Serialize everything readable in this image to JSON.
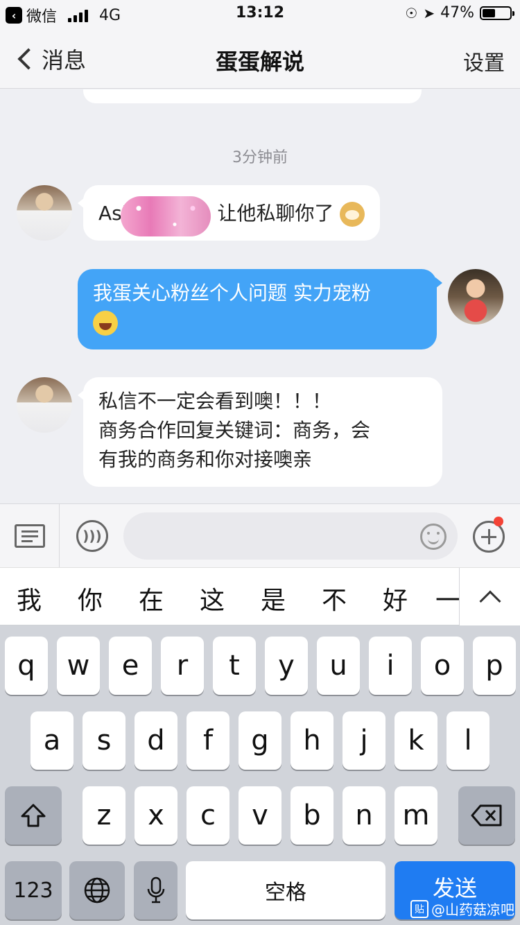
{
  "status_bar": {
    "carrier": "微信",
    "network": "4G",
    "time": "13:12",
    "battery": "47%",
    "battery_level": 0.47
  },
  "nav": {
    "back_label": "消息",
    "title": "蛋蛋解说",
    "right_label": "设置"
  },
  "chat": {
    "timestamp": "3分钟前",
    "messages": [
      {
        "direction": "in",
        "text_before": "Asl",
        "text_after": "让他私聊你了",
        "emoji": "doge"
      },
      {
        "direction": "out",
        "text": "我蛋关心粉丝个人问题 实力宠粉",
        "emoji": "laugh"
      },
      {
        "direction": "in",
        "lines": [
          "私信不一定会看到噢！！！",
          "商务合作回复关键词：商务，会",
          "有我的商务和你对接噢亲"
        ]
      }
    ]
  },
  "input": {
    "value": "",
    "placeholder": ""
  },
  "candidates": [
    "我",
    "你",
    "在",
    "这",
    "是",
    "不",
    "好",
    "一"
  ],
  "keyboard": {
    "row1": [
      "q",
      "w",
      "e",
      "r",
      "t",
      "y",
      "u",
      "i",
      "o",
      "p"
    ],
    "row2": [
      "a",
      "s",
      "d",
      "f",
      "g",
      "h",
      "j",
      "k",
      "l"
    ],
    "row3": [
      "z",
      "x",
      "c",
      "v",
      "b",
      "n",
      "m"
    ],
    "numbers_label": "123",
    "space_label": "空格",
    "send_label": "发送"
  },
  "watermark": {
    "badge": "贴",
    "text": "@山药菇凉吧"
  },
  "colors": {
    "outgoing_bubble": "#43a4f7",
    "send_key": "#1f7cf2",
    "badge_dot": "#f44336"
  }
}
